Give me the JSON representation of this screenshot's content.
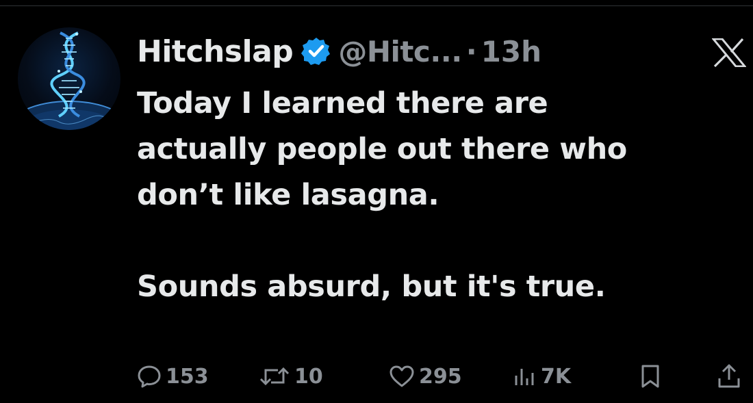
{
  "tweet": {
    "author": {
      "display_name": "Hitchslap",
      "handle": "@Hitc...",
      "verified": true,
      "avatar_icon": "dna-helix-over-earth-avatar"
    },
    "separator": "·",
    "time": "13h",
    "platform_icon": "x-logo-icon",
    "text_lines": [
      "Today I learned there are",
      "actually people out there who",
      "don’t like lasagna."
    ],
    "text_line_2": "Sounds absurd, but it's true.",
    "actions": {
      "replies": "153",
      "reposts": "10",
      "likes": "295",
      "views": "7K"
    }
  },
  "colors": {
    "background": "#000000",
    "primary_text": "#e7e9ea",
    "secondary_text": "#8b9096",
    "verified_blue": "#1d9bf0"
  }
}
